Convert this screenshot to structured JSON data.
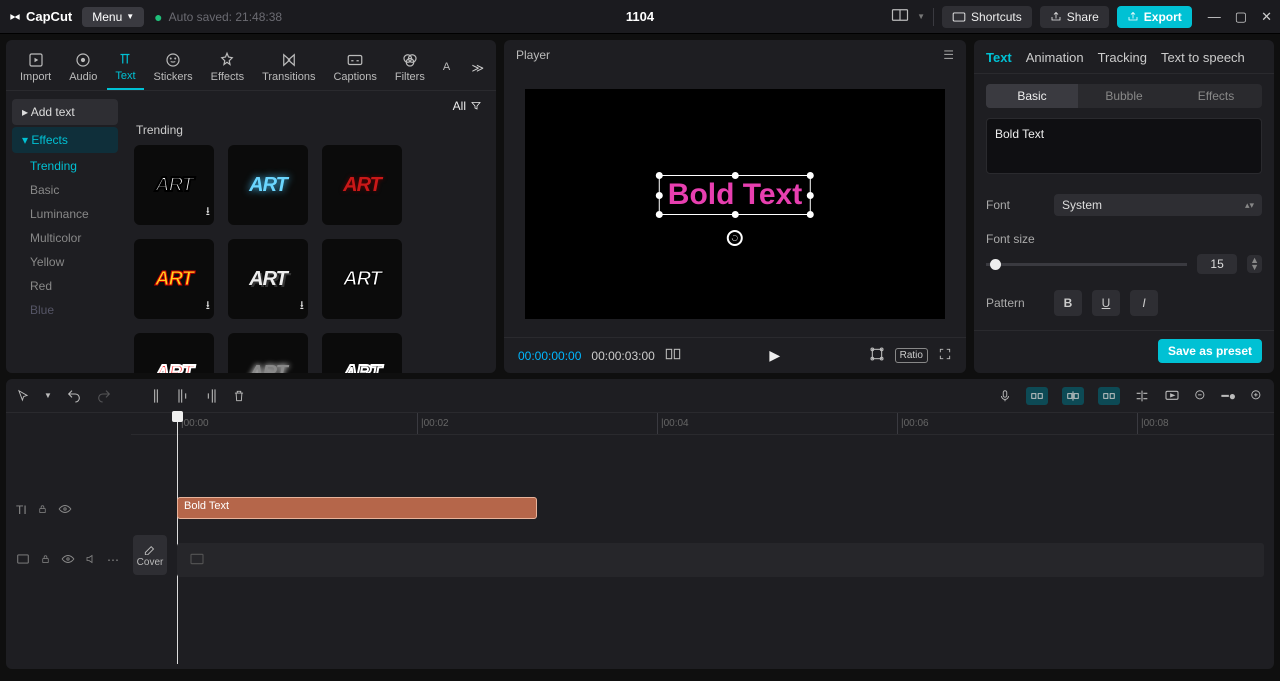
{
  "app_name": "CapCut",
  "menu_label": "Menu",
  "autosave": "Auto saved: 21:48:38",
  "project_title": "1104",
  "titlebar": {
    "shortcuts": "Shortcuts",
    "share": "Share",
    "export": "Export"
  },
  "lib_tabs": {
    "import": "Import",
    "audio": "Audio",
    "text": "Text",
    "stickers": "Stickers",
    "effects": "Effects",
    "transitions": "Transitions",
    "captions": "Captions",
    "filters": "Filters",
    "adjust": "A"
  },
  "lib_side": {
    "add_text": "Add text",
    "effects": "Effects",
    "trending": "Trending",
    "basic": "Basic",
    "luminance": "Luminance",
    "multicolor": "Multicolor",
    "yellow": "Yellow",
    "red": "Red",
    "blue": "Blue"
  },
  "lib_all": "All",
  "lib_section": "Trending",
  "art_label": "ART",
  "player": {
    "title": "Player",
    "text_on_canvas": "Bold Text",
    "time_current": "00:00:00:00",
    "time_total": "00:00:03:00",
    "ratio": "Ratio"
  },
  "inspector": {
    "tabs": {
      "text": "Text",
      "animation": "Animation",
      "tracking": "Tracking",
      "tts": "Text to speech"
    },
    "sub": {
      "basic": "Basic",
      "bubble": "Bubble",
      "effects": "Effects"
    },
    "text_value": "Bold Text",
    "font_label": "Font",
    "font_value": "System",
    "size_label": "Font size",
    "size_value": "15",
    "pattern_label": "Pattern",
    "save_preset": "Save as preset"
  },
  "timeline": {
    "ticks": [
      "|00:00",
      "|00:02",
      "|00:04",
      "|00:06",
      "|00:08"
    ],
    "clip_label": "Bold Text",
    "cover": "Cover"
  }
}
